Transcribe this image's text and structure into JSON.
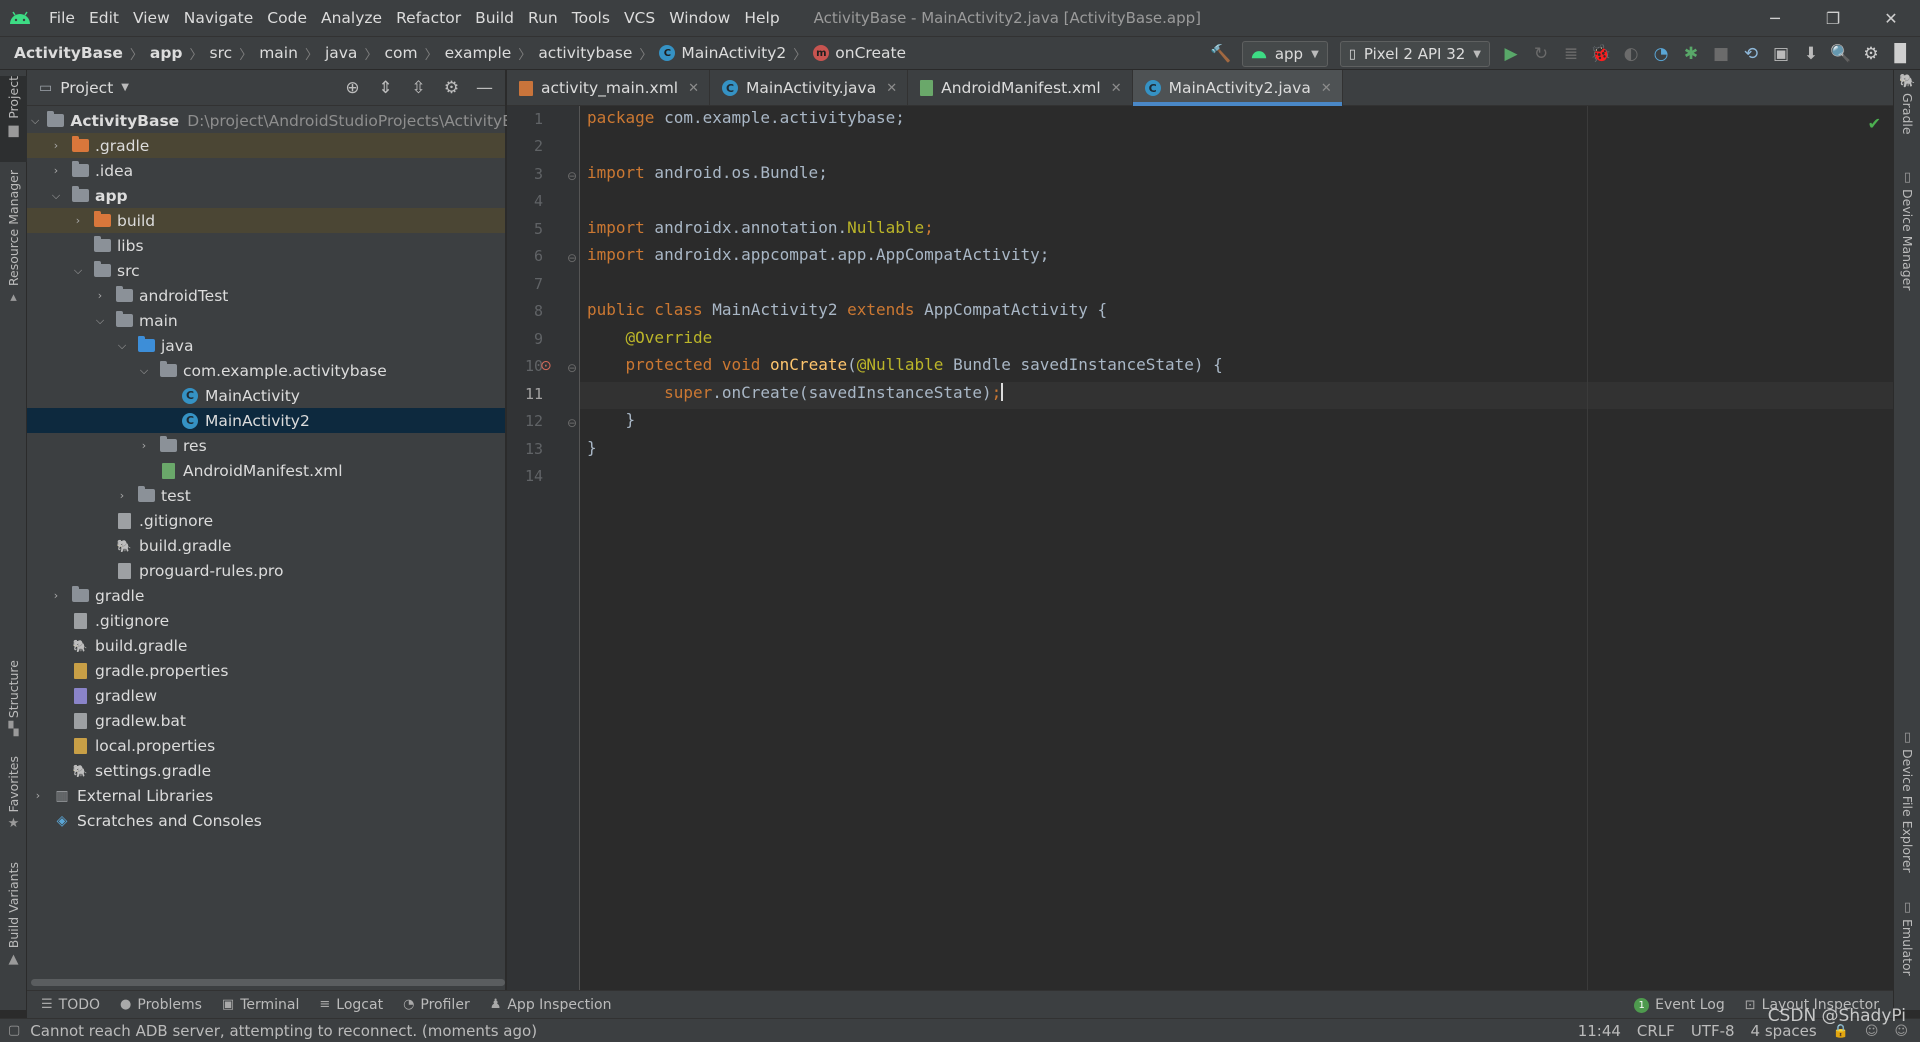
{
  "menubar": {
    "items": [
      "File",
      "Edit",
      "View",
      "Navigate",
      "Code",
      "Analyze",
      "Refactor",
      "Build",
      "Run",
      "Tools",
      "VCS",
      "Window",
      "Help"
    ],
    "title": "ActivityBase - MainActivity2.java [ActivityBase.app]"
  },
  "breadcrumb": {
    "items": [
      "ActivityBase",
      "app",
      "src",
      "main",
      "java",
      "com",
      "example",
      "activitybase",
      "MainActivity2",
      "onCreate"
    ]
  },
  "toolbar": {
    "run_config": "app",
    "device": "Pixel 2 API 32"
  },
  "left_strip": {
    "project": "Project",
    "resource_manager": "Resource Manager",
    "structure": "Structure",
    "favorites": "Favorites",
    "build_variants": "Build Variants"
  },
  "right_strip": {
    "gradle": "Gradle",
    "device_manager": "Device Manager",
    "device_file_explorer": "Device File Explorer",
    "emulator": "Emulator"
  },
  "project_panel": {
    "title": "Project",
    "root_path": "D:\\project\\AndroidStudioProjects\\ActivityBase",
    "tree": [
      {
        "label": "ActivityBase",
        "arrow": "open"
      },
      {
        "label": ".gradle",
        "arrow": "closed"
      },
      {
        "label": ".idea",
        "arrow": "closed"
      },
      {
        "label": "app",
        "arrow": "open"
      },
      {
        "label": "build",
        "arrow": "closed"
      },
      {
        "label": "libs",
        "arrow": "none"
      },
      {
        "label": "src",
        "arrow": "open"
      },
      {
        "label": "androidTest",
        "arrow": "closed"
      },
      {
        "label": "main",
        "arrow": "open"
      },
      {
        "label": "java",
        "arrow": "open"
      },
      {
        "label": "com.example.activitybase",
        "arrow": "open"
      },
      {
        "label": "MainActivity",
        "arrow": "none"
      },
      {
        "label": "MainActivity2",
        "arrow": "none"
      },
      {
        "label": "res",
        "arrow": "closed"
      },
      {
        "label": "AndroidManifest.xml",
        "arrow": "none"
      },
      {
        "label": "test",
        "arrow": "closed"
      },
      {
        "label": ".gitignore",
        "arrow": "none"
      },
      {
        "label": "build.gradle",
        "arrow": "none"
      },
      {
        "label": "proguard-rules.pro",
        "arrow": "none"
      },
      {
        "label": "gradle",
        "arrow": "closed"
      },
      {
        "label": ".gitignore",
        "arrow": "none"
      },
      {
        "label": "build.gradle",
        "arrow": "none"
      },
      {
        "label": "gradle.properties",
        "arrow": "none"
      },
      {
        "label": "gradlew",
        "arrow": "none"
      },
      {
        "label": "gradlew.bat",
        "arrow": "none"
      },
      {
        "label": "local.properties",
        "arrow": "none"
      },
      {
        "label": "settings.gradle",
        "arrow": "none"
      },
      {
        "label": "External Libraries",
        "arrow": "closed"
      },
      {
        "label": "Scratches and Consoles",
        "arrow": "none"
      }
    ]
  },
  "editor": {
    "tabs": [
      {
        "label": "activity_main.xml",
        "active": false
      },
      {
        "label": "MainActivity.java",
        "active": false
      },
      {
        "label": "AndroidManifest.xml",
        "active": false
      },
      {
        "label": "MainActivity2.java",
        "active": true
      }
    ],
    "line_numbers": [
      "1",
      "2",
      "3",
      "4",
      "5",
      "6",
      "7",
      "8",
      "9",
      "10",
      "11",
      "12",
      "13",
      "14"
    ],
    "current_line": "11",
    "code": {
      "l1_kw": "package",
      "l1_rest": " com.example.activitybase;",
      "l3_kw": "import",
      "l3_rest": " android.os.Bundle;",
      "l5_kw": "import",
      "l5_mid": " androidx.annotation.",
      "l5_an": "Nullable",
      "l5_end": ";",
      "l6_kw": "import",
      "l6_rest": " androidx.appcompat.app.AppCompatActivity;",
      "l8_kw1": "public class",
      "l8_name": " MainActivity2 ",
      "l8_kw2": "extends",
      "l8_rest": " AppCompatActivity {",
      "l9_an": "@Override",
      "l10_kw": "protected void",
      "l10_fn": "onCreate",
      "l10_paren": "(",
      "l10_an": "@Nullable",
      "l10_rest": " Bundle savedInstanceState) {",
      "l11_kw": "super",
      "l11_rest": ".onCreate(savedInstanceState)",
      "l11_semi": ";",
      "l12": "}",
      "l13": "}"
    }
  },
  "bottom_tools": {
    "todo": "TODO",
    "problems": "Problems",
    "terminal": "Terminal",
    "logcat": "Logcat",
    "profiler": "Profiler",
    "app_inspection": "App Inspection",
    "event_log_count": "1",
    "event_log": "Event Log",
    "layout_inspector": "Layout Inspector"
  },
  "status": {
    "message": "Cannot reach ADB server, attempting to reconnect. (moments ago)",
    "position": "11:44",
    "line_sep": "CRLF",
    "encoding": "UTF-8",
    "indent": "4 spaces"
  },
  "watermark": "CSDN @ShadyPi",
  "colors": {
    "accent": "#4a88c7",
    "keyword": "#cc7832",
    "annotation": "#bbb529",
    "function": "#ffc66d",
    "identifier": "#a9b7c6",
    "android_green": "#3ddc84"
  }
}
